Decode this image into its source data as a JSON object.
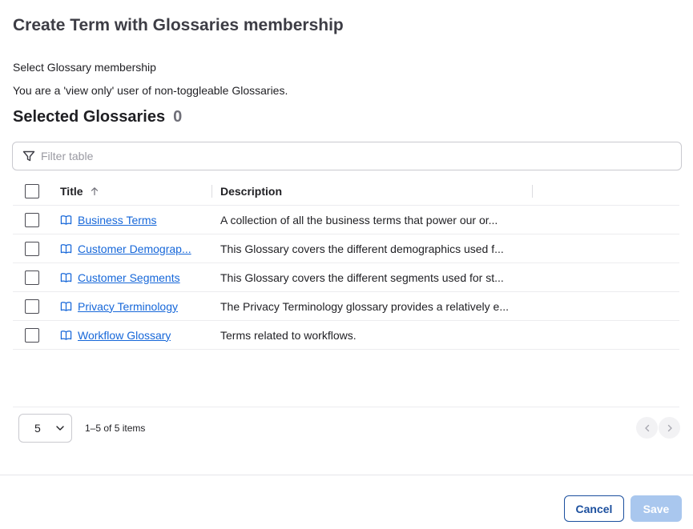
{
  "dialog": {
    "title": "Create Term with Glossaries membership",
    "line1": "Select Glossary membership",
    "line2": "You are a 'view only' user of non-toggleable Glossaries."
  },
  "selected": {
    "title": "Selected Glossaries",
    "count": "0"
  },
  "filter": {
    "placeholder": "Filter table"
  },
  "table": {
    "columns": {
      "title": "Title",
      "description": "Description"
    },
    "sort": "ascending",
    "rows": [
      {
        "title": "Business Terms",
        "description": "A collection of all the business terms that power our or..."
      },
      {
        "title": "Customer Demograp...",
        "description": "This Glossary covers the different demographics used f..."
      },
      {
        "title": "Customer Segments",
        "description": "This Glossary covers the different segments used for st..."
      },
      {
        "title": "Privacy Terminology",
        "description": "The Privacy Terminology glossary provides a relatively e..."
      },
      {
        "title": "Workflow Glossary",
        "description": "Terms related to workflows."
      }
    ]
  },
  "pagination": {
    "page_size": "5",
    "info": "1–5 of 5 items"
  },
  "footer": {
    "cancel": "Cancel",
    "save": "Save"
  },
  "colors": {
    "link": "#1667d9",
    "primary": "#1b4f9e",
    "primary_disabled": "#a9c7ee"
  },
  "icons": [
    "filter-icon",
    "sort-ascending-icon",
    "glossary-book-icon",
    "chevron-down-icon",
    "chevron-left-icon",
    "chevron-right-icon"
  ]
}
